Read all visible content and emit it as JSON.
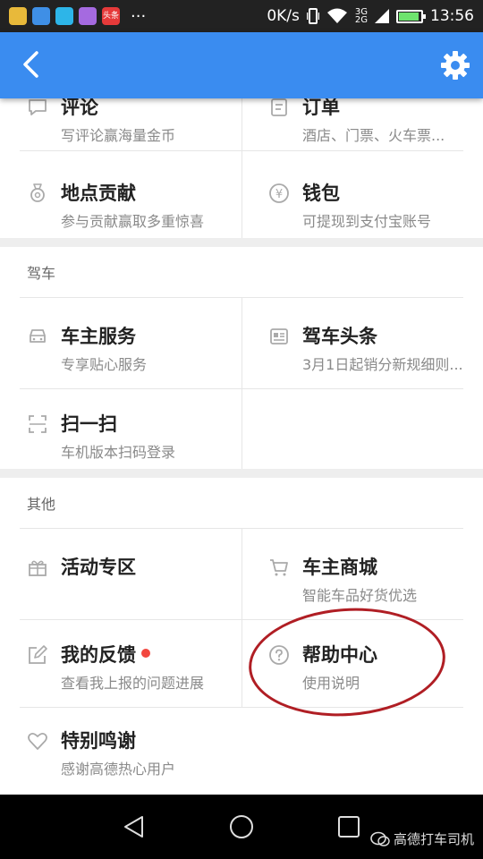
{
  "status_bar": {
    "net_speed": "0K/s",
    "net_3g": "3G",
    "net_2g": "2G",
    "time": "13:56",
    "battery_level": 0.85,
    "app_badge_text": "头条"
  },
  "sections": {
    "top": {
      "items": [
        {
          "title": "评论",
          "subtitle": "写评论赢海量金币",
          "icon": "comment-icon"
        },
        {
          "title": "订单",
          "subtitle": "酒店、门票、火车票...",
          "icon": "order-icon"
        },
        {
          "title": "地点贡献",
          "subtitle": "参与贡献赢取多重惊喜",
          "icon": "medal-icon"
        },
        {
          "title": "钱包",
          "subtitle": "可提现到支付宝账号",
          "icon": "wallet-icon"
        }
      ]
    },
    "driving": {
      "title": "驾车",
      "items": [
        {
          "title": "车主服务",
          "subtitle": "专享贴心服务",
          "icon": "car-icon"
        },
        {
          "title": "驾车头条",
          "subtitle": "3月1日起销分新规细则...",
          "icon": "news-icon"
        },
        {
          "title": "扫一扫",
          "subtitle": "车机版本扫码登录",
          "icon": "scan-icon"
        }
      ]
    },
    "other": {
      "title": "其他",
      "items": [
        {
          "title": "活动专区",
          "subtitle": "",
          "icon": "gift-icon"
        },
        {
          "title": "车主商城",
          "subtitle": "智能车品好货优选",
          "icon": "cart-icon"
        },
        {
          "title": "我的反馈",
          "subtitle": "查看我上报的问题进展",
          "icon": "edit-icon"
        },
        {
          "title": "帮助中心",
          "subtitle": "使用说明",
          "icon": "help-icon"
        },
        {
          "title": "特别鸣谢",
          "subtitle": "感谢高德热心用户",
          "icon": "heart-icon"
        }
      ]
    }
  },
  "watermark": "高德打车司机",
  "colors": {
    "app_bar": "#3a8cf0",
    "badge_dot": "#f2473f",
    "highlight_ring": "#b01e24"
  }
}
